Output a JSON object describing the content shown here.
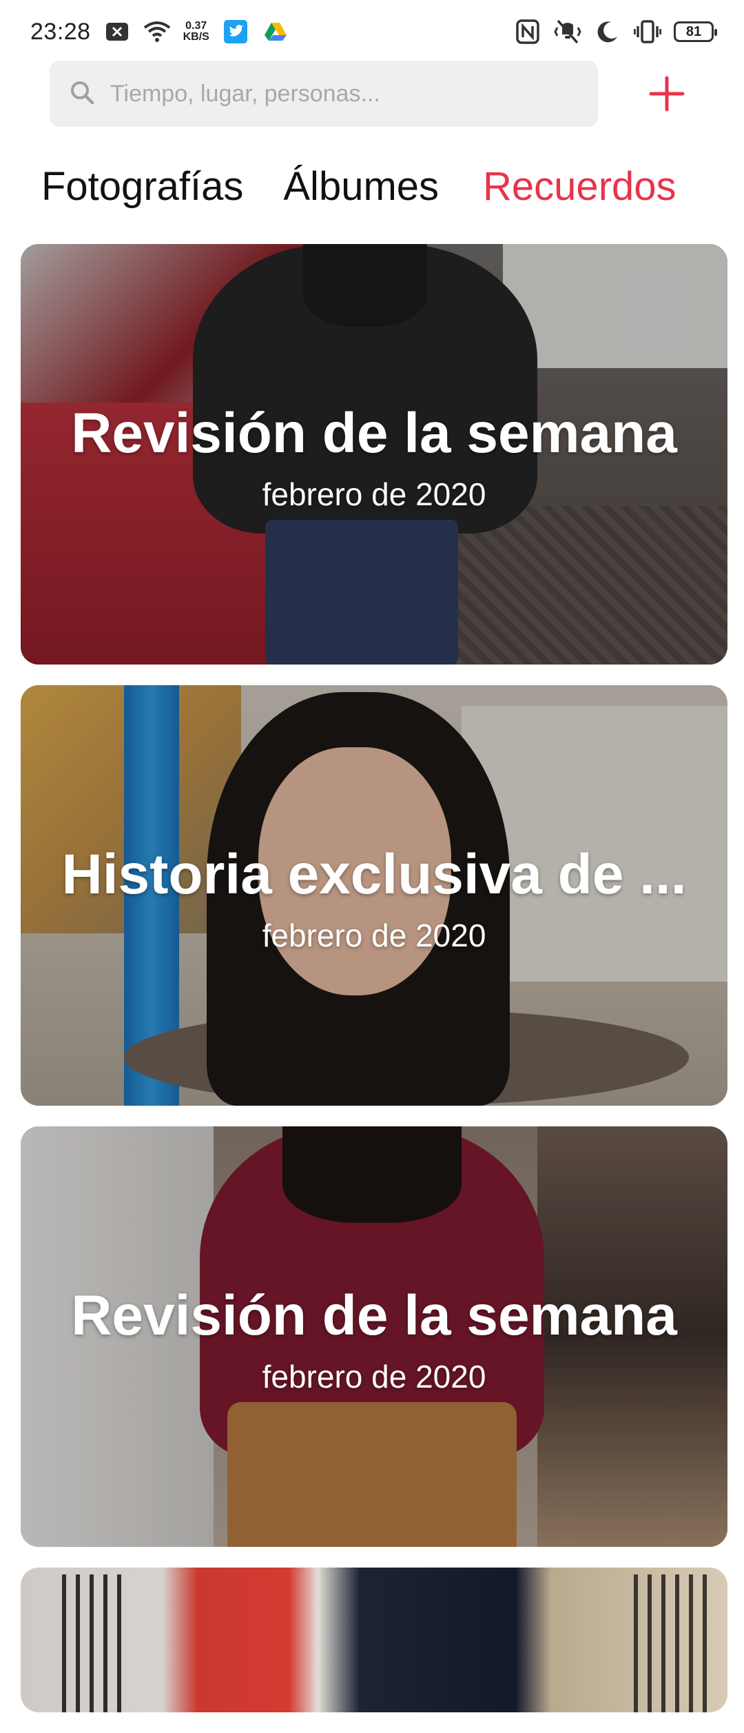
{
  "status_bar": {
    "time": "23:28",
    "speed_value": "0.37",
    "speed_unit": "KB/S",
    "battery": "81"
  },
  "search": {
    "placeholder": "Tiempo, lugar, personas..."
  },
  "tabs": [
    {
      "label": "Fotografías",
      "active": false
    },
    {
      "label": "Álbumes",
      "active": false
    },
    {
      "label": "Recuerdos",
      "active": true
    }
  ],
  "cards": [
    {
      "title": "Revisión de la semana",
      "date": "febrero de 2020"
    },
    {
      "title": "Historia exclusiva de ...",
      "date": "febrero de 2020"
    },
    {
      "title": "Revisión de la semana",
      "date": "febrero de 2020"
    }
  ],
  "colors": {
    "accent": "#e8334a",
    "search_bg": "#efefef"
  }
}
